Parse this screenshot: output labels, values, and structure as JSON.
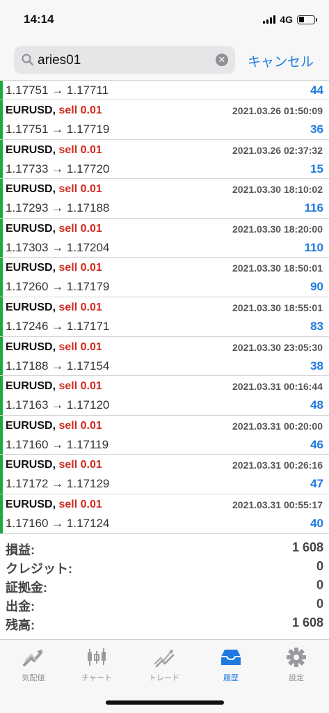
{
  "status": {
    "time": "14:14",
    "network": "4G"
  },
  "search": {
    "query": "aries01",
    "cancel_label": "キャンセル"
  },
  "trades": [
    {
      "prices": "1.17751 → 1.17711",
      "profit": "44",
      "partial": true
    },
    {
      "symbol": "EURUSD,",
      "side": "sell 0.01",
      "date": "2021.03.26 01:50:09",
      "prices": "1.17751 → 1.17719",
      "profit": "36"
    },
    {
      "symbol": "EURUSD,",
      "side": "sell 0.01",
      "date": "2021.03.26 02:37:32",
      "prices": "1.17733 → 1.17720",
      "profit": "15"
    },
    {
      "symbol": "EURUSD,",
      "side": "sell 0.01",
      "date": "2021.03.30 18:10:02",
      "prices": "1.17293 → 1.17188",
      "profit": "116"
    },
    {
      "symbol": "EURUSD,",
      "side": "sell 0.01",
      "date": "2021.03.30 18:20:00",
      "prices": "1.17303 → 1.17204",
      "profit": "110"
    },
    {
      "symbol": "EURUSD,",
      "side": "sell 0.01",
      "date": "2021.03.30 18:50:01",
      "prices": "1.17260 → 1.17179",
      "profit": "90"
    },
    {
      "symbol": "EURUSD,",
      "side": "sell 0.01",
      "date": "2021.03.30 18:55:01",
      "prices": "1.17246 → 1.17171",
      "profit": "83"
    },
    {
      "symbol": "EURUSD,",
      "side": "sell 0.01",
      "date": "2021.03.30 23:05:30",
      "prices": "1.17188 → 1.17154",
      "profit": "38"
    },
    {
      "symbol": "EURUSD,",
      "side": "sell 0.01",
      "date": "2021.03.31 00:16:44",
      "prices": "1.17163 → 1.17120",
      "profit": "48"
    },
    {
      "symbol": "EURUSD,",
      "side": "sell 0.01",
      "date": "2021.03.31 00:20:00",
      "prices": "1.17160 → 1.17119",
      "profit": "46"
    },
    {
      "symbol": "EURUSD,",
      "side": "sell 0.01",
      "date": "2021.03.31 00:26:16",
      "prices": "1.17172 → 1.17129",
      "profit": "47"
    },
    {
      "symbol": "EURUSD,",
      "side": "sell 0.01",
      "date": "2021.03.31 00:55:17",
      "prices": "1.17160 → 1.17124",
      "profit": "40"
    }
  ],
  "summary": [
    {
      "label": "損益:",
      "value": "1 608"
    },
    {
      "label": "クレジット:",
      "value": "0"
    },
    {
      "label": "証拠金:",
      "value": "0"
    },
    {
      "label": "出金:",
      "value": "0"
    },
    {
      "label": "残高:",
      "value": "1 608"
    }
  ],
  "tabs": [
    {
      "label": "気配値",
      "icon": "quotes-icon"
    },
    {
      "label": "チャート",
      "icon": "chart-icon"
    },
    {
      "label": "トレード",
      "icon": "trade-icon"
    },
    {
      "label": "履歴",
      "icon": "history-icon",
      "active": true
    },
    {
      "label": "設定",
      "icon": "settings-icon"
    }
  ],
  "colors": {
    "accent": "#1f7ae0",
    "sell": "#d12b1f",
    "profit_bar": "#1aab3a"
  }
}
